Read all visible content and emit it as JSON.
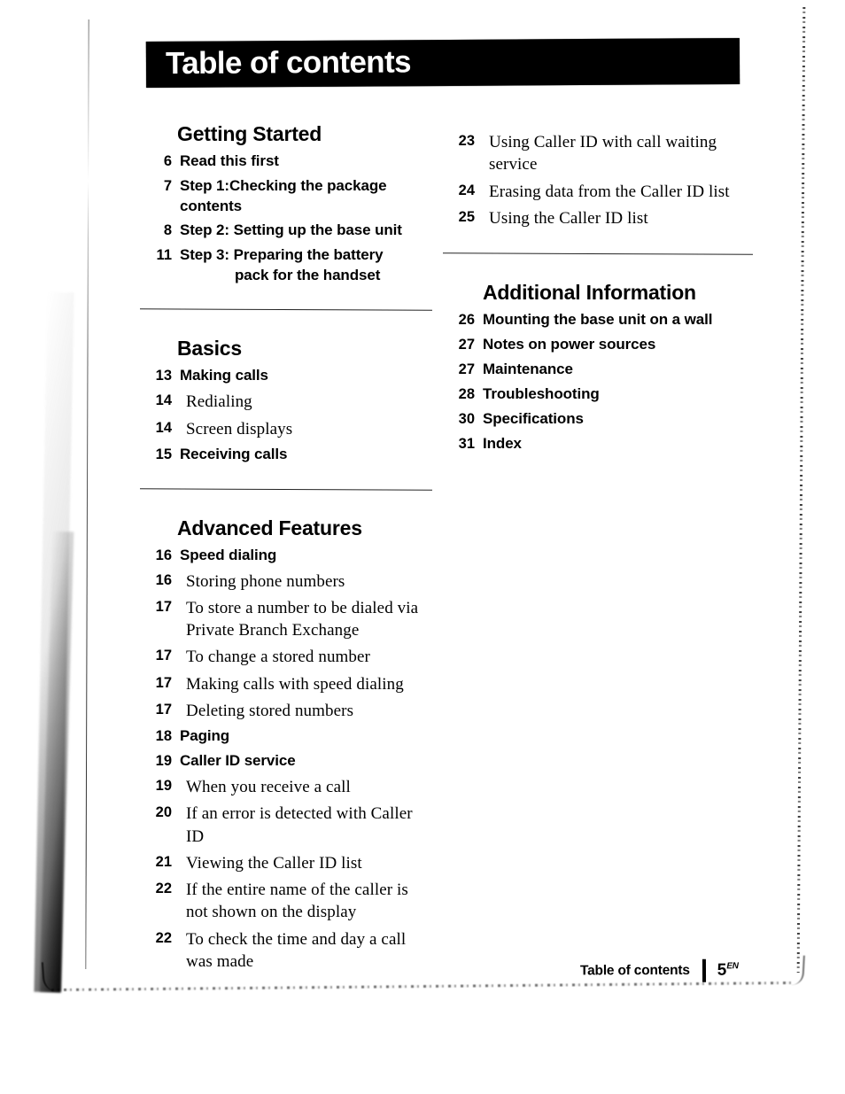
{
  "header": {
    "title": "Table of contents"
  },
  "footer": {
    "label": "Table of contents",
    "page_number": "5",
    "page_suffix": "EN"
  },
  "columns": {
    "left": [
      {
        "type": "section",
        "title": "Getting Started",
        "entries": [
          {
            "level": "main",
            "page": "6",
            "text": "Read this first"
          },
          {
            "level": "main",
            "page": "7",
            "text": "Step 1:Checking the package contents"
          },
          {
            "level": "main",
            "page": "8",
            "text": "Step 2: Setting up the base unit"
          },
          {
            "level": "main",
            "page": "11",
            "text": "Step 3: Preparing the battery",
            "hanging_line": "pack for the handset"
          }
        ]
      },
      {
        "type": "section",
        "title": "Basics",
        "entries": [
          {
            "level": "main",
            "page": "13",
            "text": "Making calls"
          },
          {
            "level": "sub",
            "page": "14",
            "text": "Redialing"
          },
          {
            "level": "sub",
            "page": "14",
            "text": "Screen displays"
          },
          {
            "level": "main",
            "page": "15",
            "text": "Receiving calls"
          }
        ]
      },
      {
        "type": "section",
        "title": "Advanced Features",
        "entries": [
          {
            "level": "main",
            "page": "16",
            "text": "Speed dialing"
          },
          {
            "level": "sub",
            "page": "16",
            "text": "Storing phone numbers"
          },
          {
            "level": "sub",
            "page": "17",
            "text": "To store a number to be dialed via Private Branch Exchange"
          },
          {
            "level": "sub",
            "page": "17",
            "text": "To change a stored number"
          },
          {
            "level": "sub",
            "page": "17",
            "text": "Making calls with speed dialing"
          },
          {
            "level": "sub",
            "page": "17",
            "text": "Deleting stored numbers"
          },
          {
            "level": "main",
            "page": "18",
            "text": "Paging"
          },
          {
            "level": "main",
            "page": "19",
            "text": "Caller ID service"
          },
          {
            "level": "sub",
            "page": "19",
            "text": "When you receive a call"
          },
          {
            "level": "sub",
            "page": "20",
            "text": "If an error is detected with Caller ID"
          },
          {
            "level": "sub",
            "page": "21",
            "text": "Viewing the Caller ID list"
          },
          {
            "level": "sub",
            "page": "22",
            "text": "If the entire name of the caller is not shown on the display"
          },
          {
            "level": "sub",
            "page": "22",
            "text": "To check the time and day a call was made"
          }
        ]
      }
    ],
    "right": [
      {
        "type": "continuation",
        "title": "",
        "entries": [
          {
            "level": "sub",
            "page": "23",
            "text": "Using Caller ID with call waiting service"
          },
          {
            "level": "sub",
            "page": "24",
            "text": "Erasing data from the Caller ID list"
          },
          {
            "level": "sub",
            "page": "25",
            "text": "Using the Caller ID list"
          }
        ]
      },
      {
        "type": "section",
        "title": "Additional Information",
        "entries": [
          {
            "level": "main",
            "page": "26",
            "text": "Mounting the base unit on a wall"
          },
          {
            "level": "main",
            "page": "27",
            "text": "Notes on power sources"
          },
          {
            "level": "main",
            "page": "27",
            "text": "Maintenance"
          },
          {
            "level": "main",
            "page": "28",
            "text": "Troubleshooting"
          },
          {
            "level": "main",
            "page": "30",
            "text": "Specifications"
          },
          {
            "level": "main",
            "page": "31",
            "text": "Index"
          }
        ]
      }
    ]
  }
}
